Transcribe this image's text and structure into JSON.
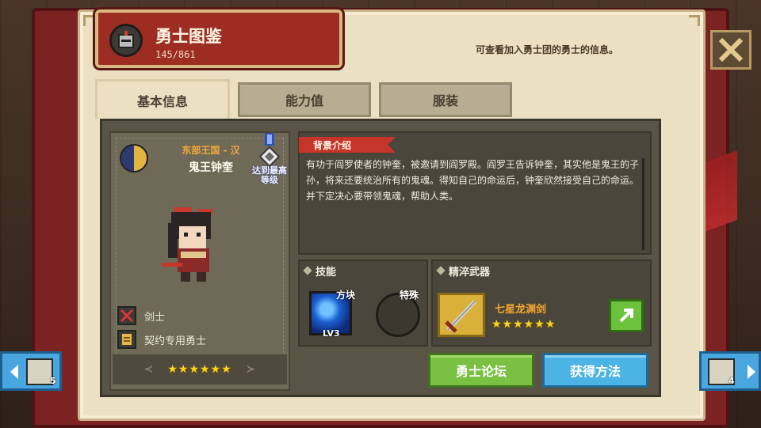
{
  "header": {
    "title": "勇士图鉴",
    "count": "145/861",
    "hint": "可查看加入勇士团的勇士的信息。",
    "close_icon": "close-x-icon"
  },
  "tabs": [
    {
      "label": "基本信息",
      "active": true
    },
    {
      "label": "能力值",
      "active": false
    },
    {
      "label": "服装",
      "active": false
    }
  ],
  "hero": {
    "kingdom": "东部王国 - 汉",
    "name": "鬼王钟奎",
    "max_level_label": "达到最高等级",
    "stars": "★★★★★★",
    "class_label": "剑士",
    "contract_label": "契约专用勇士"
  },
  "bio": {
    "heading": "背景介绍",
    "text": "有功于阎罗使者的钟奎，被邀请到阎罗殿。阎罗王告诉钟奎，其实他是鬼王的子孙，将来还要统治所有的鬼魂。得知自己的命运后，钟奎欣然接受自己的命运。并下定决心要带领鬼魂，帮助人类。"
  },
  "skills": {
    "heading": "技能",
    "skill_label": "方块",
    "skill_level": "LV3",
    "special_label": "特殊"
  },
  "weapon": {
    "heading": "精淬武器",
    "name": "七星龙渊剑",
    "stars": "★★★★★★"
  },
  "buttons": {
    "forum": "勇士论坛",
    "obtain": "获得方法"
  },
  "nav": {
    "prev_stars": "5",
    "next_stars": "4"
  },
  "colors": {
    "title_plate": "#9d2c23",
    "kingdom": "#f2a83b",
    "star": "#ffd21c",
    "green_button": "#7ac043",
    "blue_button": "#4bb4e4"
  }
}
